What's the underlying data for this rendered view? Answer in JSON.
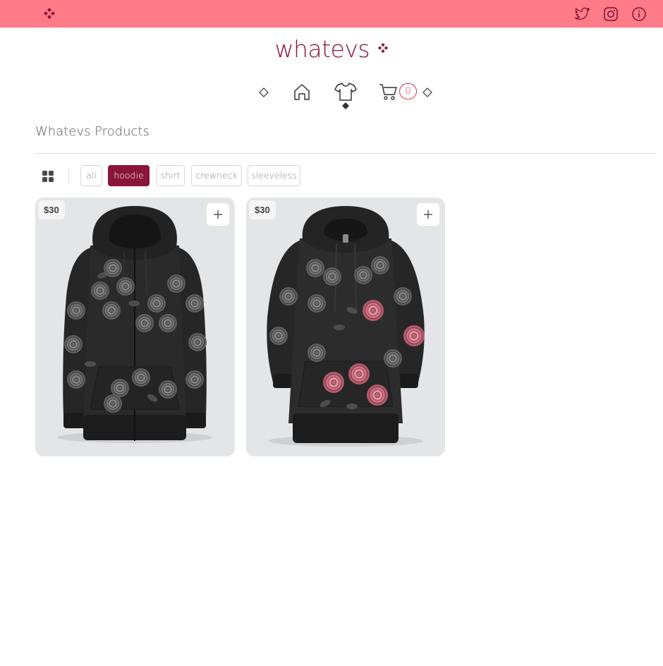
{
  "topbar": {
    "icons": [
      "logo-mark",
      "twitter-icon",
      "instagram-icon",
      "info-icon"
    ]
  },
  "brand": {
    "name": "whatevs",
    "icon": "four-diamonds-mark"
  },
  "nav": {
    "items": [
      {
        "icon": "home-icon"
      },
      {
        "icon": "shirt-icon",
        "active": true
      },
      {
        "icon": "cart-icon"
      }
    ],
    "cart_count": "0"
  },
  "page": {
    "title": "Whatevs Products"
  },
  "filters": {
    "view_icon": "grid-view-icon",
    "chips": [
      {
        "label": "all",
        "active": false
      },
      {
        "label": "hoodie",
        "active": true
      },
      {
        "label": "shirt",
        "active": false
      },
      {
        "label": "crewneck",
        "active": false
      },
      {
        "label": "sleeveless",
        "active": false
      }
    ]
  },
  "products": [
    {
      "price": "$30",
      "variant": "zip-up hoodie with grey roses",
      "add_icon": "plus-icon"
    },
    {
      "price": "$30",
      "variant": "pullover hoodie with pink roses",
      "add_icon": "plus-icon"
    }
  ],
  "colors": {
    "topbar": "#ff7b88",
    "brand": "#8a1538",
    "active_chip": "#8a1538",
    "cart_badge": "#d63a55"
  }
}
